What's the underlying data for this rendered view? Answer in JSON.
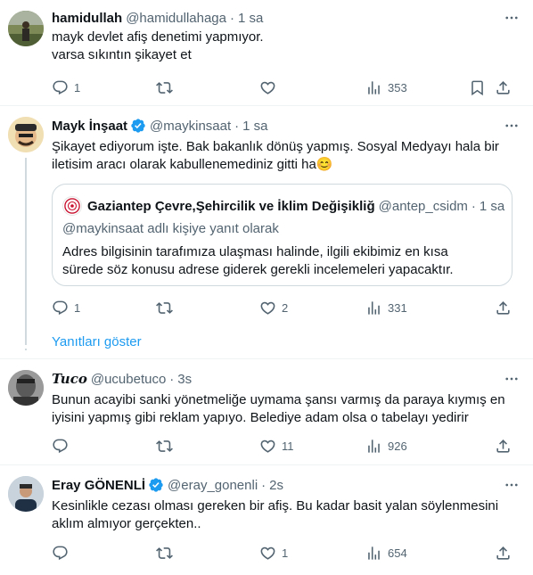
{
  "tweets": [
    {
      "name": "hamidullah",
      "handle": "@hamidullahaga",
      "time": "1 sa",
      "lines": [
        "mayk devlet afiş denetimi yapmıyor.",
        "varsa sıkıntın şikayet et"
      ],
      "replies": "1",
      "retweets": "",
      "likes": "",
      "views": "353",
      "verified": false
    },
    {
      "name": "Mayk İnşaat",
      "handle": "@maykinsaat",
      "time": "1 sa",
      "lines": [
        "Şikayet ediyorum işte. Bak bakanlık dönüş yapmış. Sosyal Medyayı hala bir",
        "iletisim aracı olarak kabullenemediniz gitti ha"
      ],
      "emoji": "😊",
      "replies": "1",
      "retweets": "",
      "likes": "2",
      "views": "331",
      "verified": true,
      "quote": {
        "name": "Gaziantep Çevre,Şehircilik ve İklim Değişikliğ",
        "handle": "@antep_csidm",
        "time": "1 sa",
        "reply_to": "@maykinsaat adlı kişiye yanıt olarak",
        "lines": [
          "Adres bilgisinin tarafımıza ulaşması halinde, ilgili ekibimiz en kısa",
          "sürede söz konusu adrese giderek gerekli incelemeleri yapacaktır."
        ]
      }
    },
    {
      "name": "Tuco",
      "handle": "@ucubetuco",
      "time": "3s",
      "lines": [
        "Bunun acayibi sanki yönetmeliğe uymama şansı varmış da paraya kıymış en",
        "iyisini yapmış gibi reklam yapıyo. Belediye adam olsa o tabelayı yedirir"
      ],
      "replies": "",
      "retweets": "",
      "likes": "11",
      "views": "926",
      "verified": false
    },
    {
      "name": "Eray GÖNENLİ",
      "handle": "@eray_gonenli",
      "time": "2s",
      "lines": [
        "Kesinlikle cezası olması gereken bir afiş. Bu kadar basit yalan söylenmesini",
        "aklım almıyor gerçekten.."
      ],
      "replies": "",
      "retweets": "",
      "likes": "1",
      "views": "654",
      "verified": true
    }
  ],
  "show_replies": "Yanıtları göster",
  "colors": {
    "accent": "#1d9bf0",
    "muted": "#536471",
    "text": "#0f1419",
    "border": "#cfd9de"
  },
  "icons": [
    "reply-icon",
    "retweet-icon",
    "like-icon",
    "views-icon",
    "bookmark-icon",
    "share-icon",
    "more-icon",
    "verified-icon"
  ]
}
